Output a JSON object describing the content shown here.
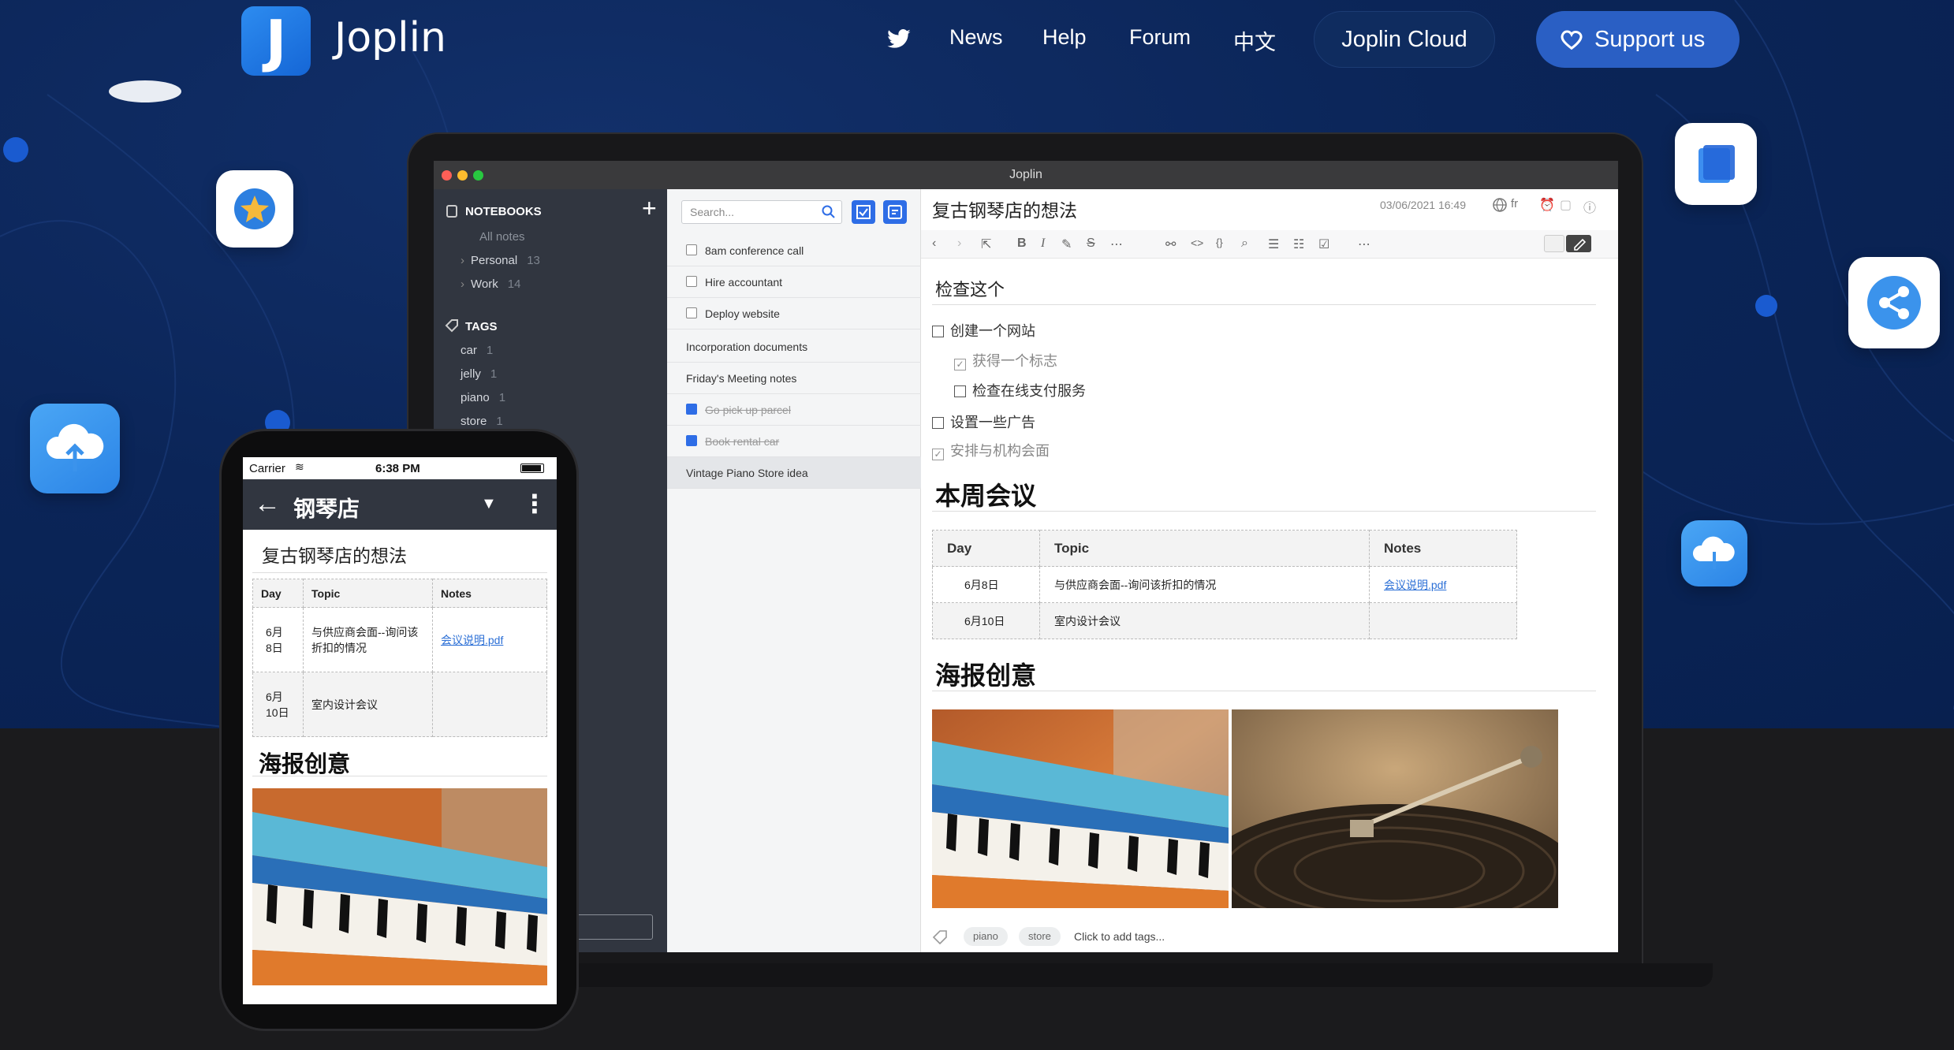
{
  "site": {
    "brand": "Joplin",
    "nav": [
      "News",
      "Help",
      "Forum",
      "中文"
    ],
    "cloud_button": "Joplin Cloud",
    "support_button": "Support us"
  },
  "colors": {
    "hero_bg": "#0b2558",
    "accent": "#2a5fc4",
    "sidebar_bg": "#313640",
    "link": "#2b6fd6"
  },
  "desktop": {
    "window_title": "Joplin",
    "sidebar": {
      "notebooks_header": "NOTEBOOKS",
      "all_notes": "All notes",
      "notebooks": [
        {
          "name": "Personal",
          "count": "13"
        },
        {
          "name": "Work",
          "count": "14"
        }
      ],
      "tags_header": "TAGS",
      "tags": [
        {
          "name": "car",
          "count": "1"
        },
        {
          "name": "jelly",
          "count": "1"
        },
        {
          "name": "piano",
          "count": "1"
        },
        {
          "name": "store",
          "count": "1"
        }
      ]
    },
    "notelist": {
      "search_placeholder": "Search...",
      "notes": [
        {
          "title": "8am conference call",
          "todo": true,
          "done": false
        },
        {
          "title": "Hire accountant",
          "todo": true,
          "done": false
        },
        {
          "title": "Deploy website",
          "todo": true,
          "done": false
        },
        {
          "title": "Incorporation documents",
          "todo": false,
          "done": false
        },
        {
          "title": "Friday's Meeting notes",
          "todo": false,
          "done": false
        },
        {
          "title": "Go pick up parcel",
          "todo": true,
          "done": true
        },
        {
          "title": "Book rental car",
          "todo": true,
          "done": true
        },
        {
          "title": "Vintage Piano Store idea",
          "todo": false,
          "done": false
        }
      ]
    },
    "editor": {
      "title": "复古钢琴店的想法",
      "date": "03/06/2021 16:49",
      "lang": "fr",
      "h_check": "检查这个",
      "todos": [
        {
          "text": "创建一个网站",
          "done": false
        },
        {
          "text": "获得一个标志",
          "done": true
        },
        {
          "text": "检查在线支付服务",
          "done": false
        },
        {
          "text": "设置一些广告",
          "done": false
        },
        {
          "text": "安排与机构会面",
          "done": true
        }
      ],
      "h_meeting": "本周会议",
      "table_headers": [
        "Day",
        "Topic",
        "Notes"
      ],
      "table_rows": [
        {
          "day": "6月8日",
          "topic": "与供应商会面--询问该折扣的情况",
          "notes": "会议说明.pdf"
        },
        {
          "day": "6月10日",
          "topic": "室内设计会议",
          "notes": ""
        }
      ],
      "h_poster": "海报创意",
      "tags": [
        "piano",
        "store"
      ],
      "add_tags": "Click to add tags..."
    }
  },
  "mobile": {
    "carrier": "Carrier",
    "time": "6:38 PM",
    "notebook_title": "钢琴店",
    "note_title": "复古钢琴店的想法",
    "table_headers": [
      "Day",
      "Topic",
      "Notes"
    ],
    "table_rows": [
      {
        "day": "6月\n8日",
        "topic": "与供应商会面--询问该折扣的情况",
        "notes": "会议说明.pdf"
      },
      {
        "day": "6月\n10日",
        "topic": "室内设计会议",
        "notes": ""
      }
    ],
    "h_poster": "海报创意"
  }
}
